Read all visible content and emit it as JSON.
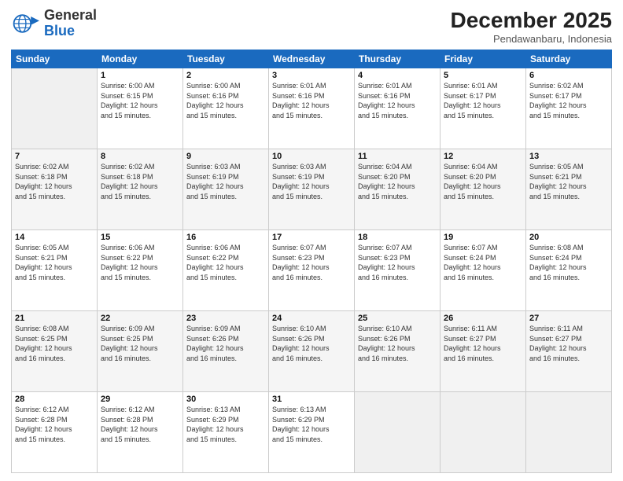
{
  "logo": {
    "line1": "General",
    "line2": "Blue"
  },
  "header": {
    "month_year": "December 2025",
    "location": "Pendawanbaru, Indonesia"
  },
  "weekdays": [
    "Sunday",
    "Monday",
    "Tuesday",
    "Wednesday",
    "Thursday",
    "Friday",
    "Saturday"
  ],
  "rows": [
    [
      {
        "day": "",
        "info": ""
      },
      {
        "day": "1",
        "info": "Sunrise: 6:00 AM\nSunset: 6:15 PM\nDaylight: 12 hours\nand 15 minutes."
      },
      {
        "day": "2",
        "info": "Sunrise: 6:00 AM\nSunset: 6:16 PM\nDaylight: 12 hours\nand 15 minutes."
      },
      {
        "day": "3",
        "info": "Sunrise: 6:01 AM\nSunset: 6:16 PM\nDaylight: 12 hours\nand 15 minutes."
      },
      {
        "day": "4",
        "info": "Sunrise: 6:01 AM\nSunset: 6:16 PM\nDaylight: 12 hours\nand 15 minutes."
      },
      {
        "day": "5",
        "info": "Sunrise: 6:01 AM\nSunset: 6:17 PM\nDaylight: 12 hours\nand 15 minutes."
      },
      {
        "day": "6",
        "info": "Sunrise: 6:02 AM\nSunset: 6:17 PM\nDaylight: 12 hours\nand 15 minutes."
      }
    ],
    [
      {
        "day": "7",
        "info": "Sunrise: 6:02 AM\nSunset: 6:18 PM\nDaylight: 12 hours\nand 15 minutes."
      },
      {
        "day": "8",
        "info": "Sunrise: 6:02 AM\nSunset: 6:18 PM\nDaylight: 12 hours\nand 15 minutes."
      },
      {
        "day": "9",
        "info": "Sunrise: 6:03 AM\nSunset: 6:19 PM\nDaylight: 12 hours\nand 15 minutes."
      },
      {
        "day": "10",
        "info": "Sunrise: 6:03 AM\nSunset: 6:19 PM\nDaylight: 12 hours\nand 15 minutes."
      },
      {
        "day": "11",
        "info": "Sunrise: 6:04 AM\nSunset: 6:20 PM\nDaylight: 12 hours\nand 15 minutes."
      },
      {
        "day": "12",
        "info": "Sunrise: 6:04 AM\nSunset: 6:20 PM\nDaylight: 12 hours\nand 15 minutes."
      },
      {
        "day": "13",
        "info": "Sunrise: 6:05 AM\nSunset: 6:21 PM\nDaylight: 12 hours\nand 15 minutes."
      }
    ],
    [
      {
        "day": "14",
        "info": "Sunrise: 6:05 AM\nSunset: 6:21 PM\nDaylight: 12 hours\nand 15 minutes."
      },
      {
        "day": "15",
        "info": "Sunrise: 6:06 AM\nSunset: 6:22 PM\nDaylight: 12 hours\nand 15 minutes."
      },
      {
        "day": "16",
        "info": "Sunrise: 6:06 AM\nSunset: 6:22 PM\nDaylight: 12 hours\nand 15 minutes."
      },
      {
        "day": "17",
        "info": "Sunrise: 6:07 AM\nSunset: 6:23 PM\nDaylight: 12 hours\nand 16 minutes."
      },
      {
        "day": "18",
        "info": "Sunrise: 6:07 AM\nSunset: 6:23 PM\nDaylight: 12 hours\nand 16 minutes."
      },
      {
        "day": "19",
        "info": "Sunrise: 6:07 AM\nSunset: 6:24 PM\nDaylight: 12 hours\nand 16 minutes."
      },
      {
        "day": "20",
        "info": "Sunrise: 6:08 AM\nSunset: 6:24 PM\nDaylight: 12 hours\nand 16 minutes."
      }
    ],
    [
      {
        "day": "21",
        "info": "Sunrise: 6:08 AM\nSunset: 6:25 PM\nDaylight: 12 hours\nand 16 minutes."
      },
      {
        "day": "22",
        "info": "Sunrise: 6:09 AM\nSunset: 6:25 PM\nDaylight: 12 hours\nand 16 minutes."
      },
      {
        "day": "23",
        "info": "Sunrise: 6:09 AM\nSunset: 6:26 PM\nDaylight: 12 hours\nand 16 minutes."
      },
      {
        "day": "24",
        "info": "Sunrise: 6:10 AM\nSunset: 6:26 PM\nDaylight: 12 hours\nand 16 minutes."
      },
      {
        "day": "25",
        "info": "Sunrise: 6:10 AM\nSunset: 6:26 PM\nDaylight: 12 hours\nand 16 minutes."
      },
      {
        "day": "26",
        "info": "Sunrise: 6:11 AM\nSunset: 6:27 PM\nDaylight: 12 hours\nand 16 minutes."
      },
      {
        "day": "27",
        "info": "Sunrise: 6:11 AM\nSunset: 6:27 PM\nDaylight: 12 hours\nand 16 minutes."
      }
    ],
    [
      {
        "day": "28",
        "info": "Sunrise: 6:12 AM\nSunset: 6:28 PM\nDaylight: 12 hours\nand 15 minutes."
      },
      {
        "day": "29",
        "info": "Sunrise: 6:12 AM\nSunset: 6:28 PM\nDaylight: 12 hours\nand 15 minutes."
      },
      {
        "day": "30",
        "info": "Sunrise: 6:13 AM\nSunset: 6:29 PM\nDaylight: 12 hours\nand 15 minutes."
      },
      {
        "day": "31",
        "info": "Sunrise: 6:13 AM\nSunset: 6:29 PM\nDaylight: 12 hours\nand 15 minutes."
      },
      {
        "day": "",
        "info": ""
      },
      {
        "day": "",
        "info": ""
      },
      {
        "day": "",
        "info": ""
      }
    ]
  ]
}
